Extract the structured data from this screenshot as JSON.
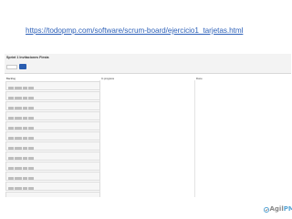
{
  "link": {
    "url_text": "https://todopmp.com/software/scrum-board/ejercicio1_tarjetas.html"
  },
  "board": {
    "title": "Sprint 1 Invitaciones Fiesta",
    "input_value": "",
    "button_label": ""
  },
  "columns": [
    {
      "label": "Backlog"
    },
    {
      "label": "In progress"
    },
    {
      "label": "Done"
    }
  ],
  "cards": [
    {
      "title": "",
      "points": ""
    },
    {
      "title": "",
      "points": ""
    },
    {
      "title": "",
      "points": ""
    },
    {
      "title": "",
      "points": ""
    },
    {
      "title": "",
      "points": ""
    },
    {
      "title": "",
      "points": ""
    },
    {
      "title": "",
      "points": ""
    },
    {
      "title": "",
      "points": ""
    },
    {
      "title": "",
      "points": ""
    },
    {
      "title": "",
      "points": ""
    },
    {
      "title": "",
      "points": ""
    },
    {
      "title": "",
      "points": ""
    }
  ],
  "logo": {
    "part1": "Agil",
    "part2": "PM"
  },
  "colors": {
    "link": "#2b5fb8",
    "brand_blue": "#5aa6d6",
    "brand_grey": "#8a8a8a",
    "button": "#2a5db0"
  }
}
